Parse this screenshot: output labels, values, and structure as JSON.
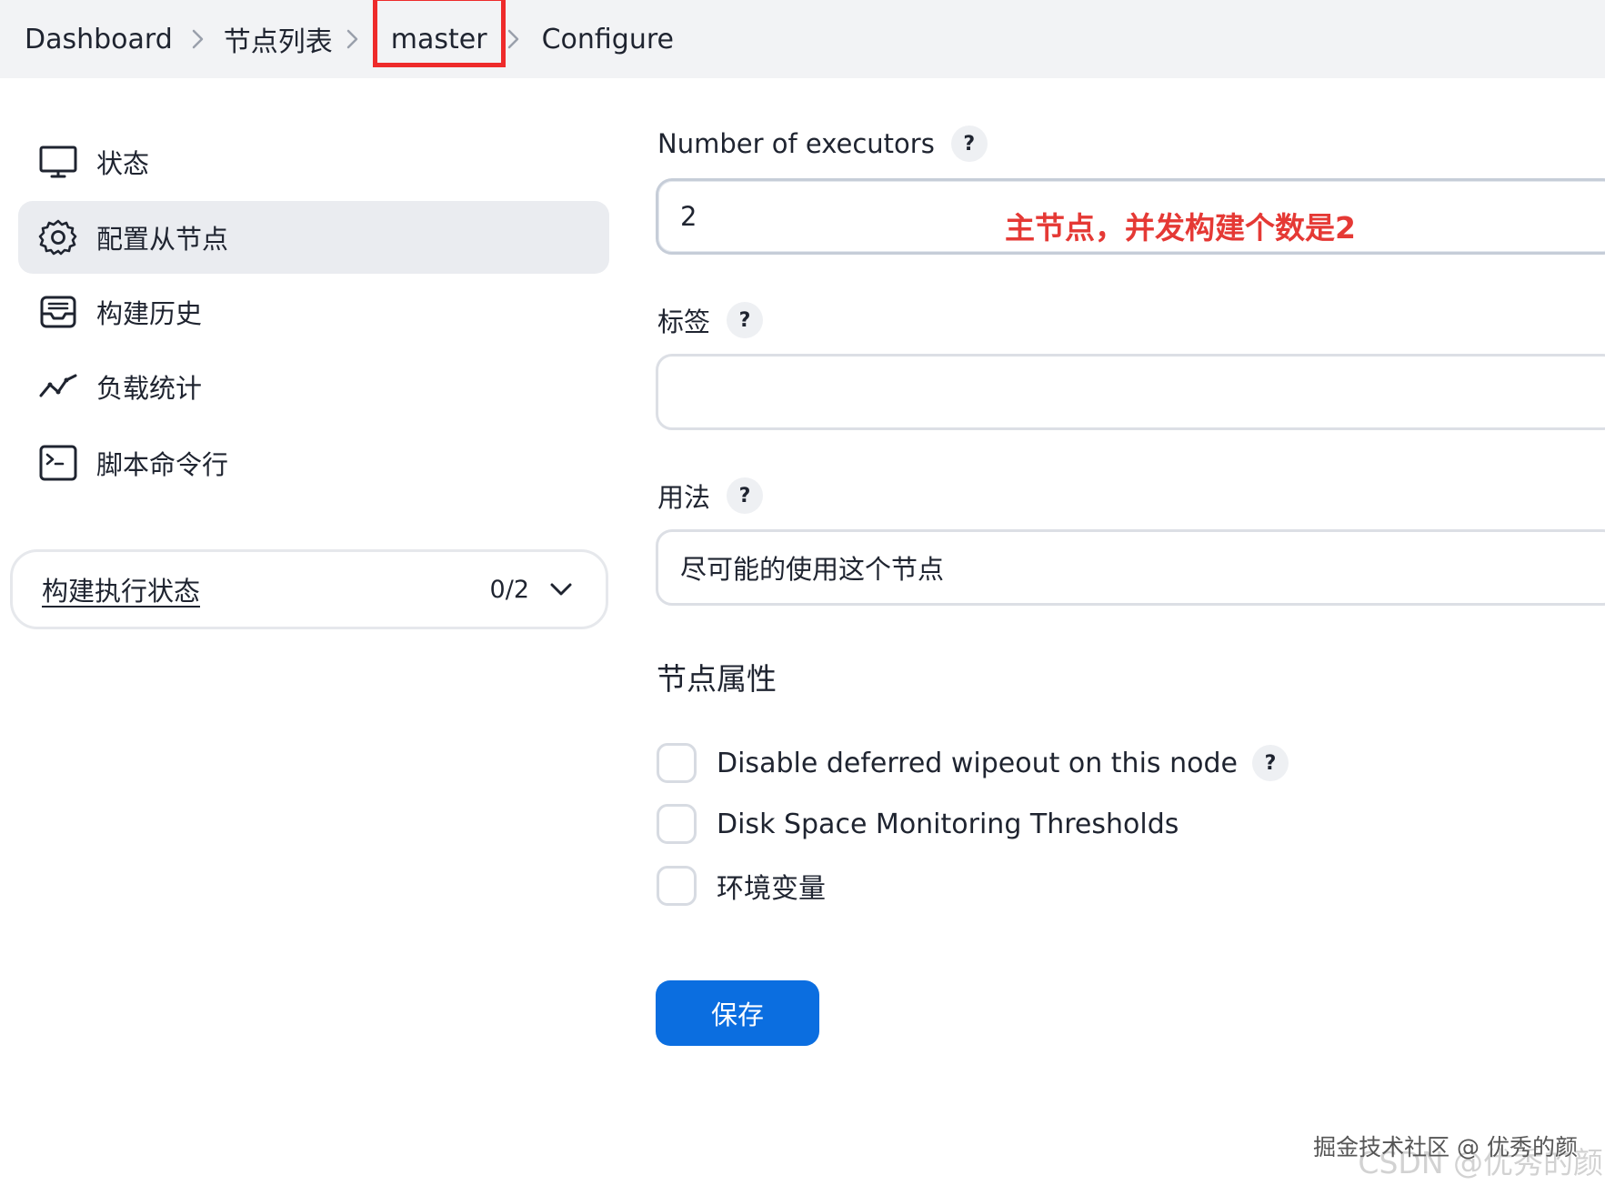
{
  "breadcrumb": {
    "items": [
      "Dashboard",
      "节点列表",
      "master",
      "Configure"
    ]
  },
  "sidebar": {
    "items": [
      {
        "label": "状态",
        "icon": "monitor-icon"
      },
      {
        "label": "配置从节点",
        "icon": "gear-icon",
        "active": true
      },
      {
        "label": "构建历史",
        "icon": "inbox-icon"
      },
      {
        "label": "负载统计",
        "icon": "line-chart-icon"
      },
      {
        "label": "脚本命令行",
        "icon": "terminal-icon"
      }
    ],
    "executor_status": {
      "title": "构建执行状态",
      "count": "0/2"
    }
  },
  "form": {
    "executors": {
      "label": "Number of executors",
      "value": "2",
      "help": "?"
    },
    "annotation": "主节点，并发构建个数是2",
    "labels": {
      "label": "标签",
      "value": "",
      "help": "?"
    },
    "usage": {
      "label": "用法",
      "value": "尽可能的使用这个节点",
      "help": "?"
    },
    "node_properties": {
      "title": "节点属性",
      "options": [
        {
          "label": "Disable deferred wipeout on this node",
          "checked": false,
          "help": "?"
        },
        {
          "label": "Disk Space Monitoring Thresholds",
          "checked": false
        },
        {
          "label": "环境变量",
          "checked": false
        }
      ]
    },
    "save_label": "保存"
  },
  "watermark": {
    "juejin": "掘金技术社区 @ 优秀的颜",
    "csdn": "CSDN @优秀的颜"
  },
  "colors": {
    "accent": "#0b6ee0",
    "highlight_box": "#ee2b2b",
    "annotation": "#e53935"
  }
}
